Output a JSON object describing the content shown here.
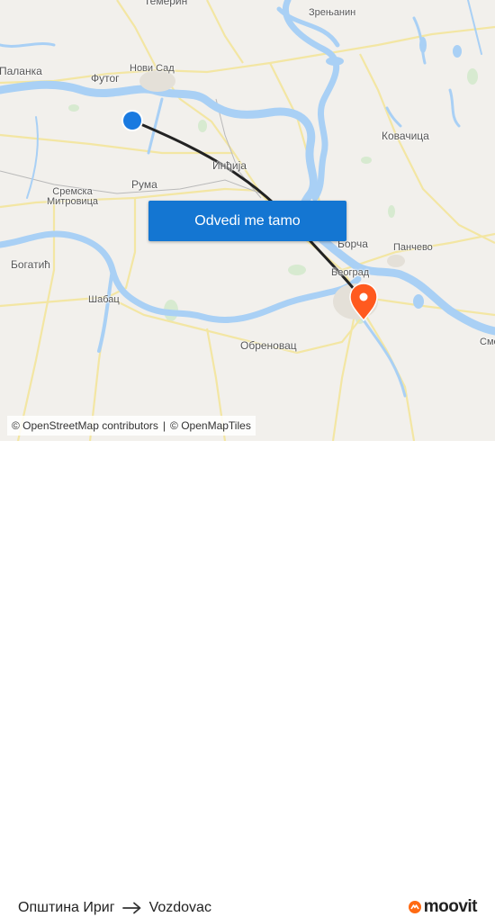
{
  "map": {
    "places": [
      {
        "key": "temerin",
        "label": "Темерин"
      },
      {
        "key": "zrenjanin",
        "label": "Зрењанин"
      },
      {
        "key": "palanka",
        "label": "Паланка"
      },
      {
        "key": "futog",
        "label": "Футог"
      },
      {
        "key": "novi_sad",
        "label": "Нови Сад"
      },
      {
        "key": "kovacica",
        "label": "Ковачица"
      },
      {
        "key": "indjija",
        "label": "Инђија"
      },
      {
        "key": "ruma",
        "label": "Рума"
      },
      {
        "key": "sremska_mitrovica",
        "label": "Сремска\nМитровица"
      },
      {
        "key": "bogatic",
        "label": "Богатић"
      },
      {
        "key": "borca",
        "label": "Борча"
      },
      {
        "key": "pancevo",
        "label": "Панчево"
      },
      {
        "key": "beograd",
        "label": "Београд"
      },
      {
        "key": "sabac",
        "label": "Шабац"
      },
      {
        "key": "obrenovac",
        "label": "Обреновац"
      },
      {
        "key": "smed_partial",
        "label": "Сме"
      }
    ],
    "colors": {
      "water": "#a9d0f5",
      "road": "#f3e6a3",
      "route": "#222222",
      "origin": "#1a7ae0",
      "destination": "#ff5a1f"
    },
    "origin_icon": "origin-dot-icon",
    "destination_icon": "destination-pin-icon"
  },
  "cta": {
    "label": "Odvedi me tamo",
    "color": "#1476d2"
  },
  "attribution": {
    "osm": "© OpenStreetMap contributors",
    "separator": "|",
    "omt": "© OpenMapTiles"
  },
  "footer": {
    "from": "Општина Ириг",
    "to": "Vozdovac",
    "arrow_icon": "arrow-right-icon",
    "brand": "moovit",
    "brand_color": "#ff6a13"
  }
}
